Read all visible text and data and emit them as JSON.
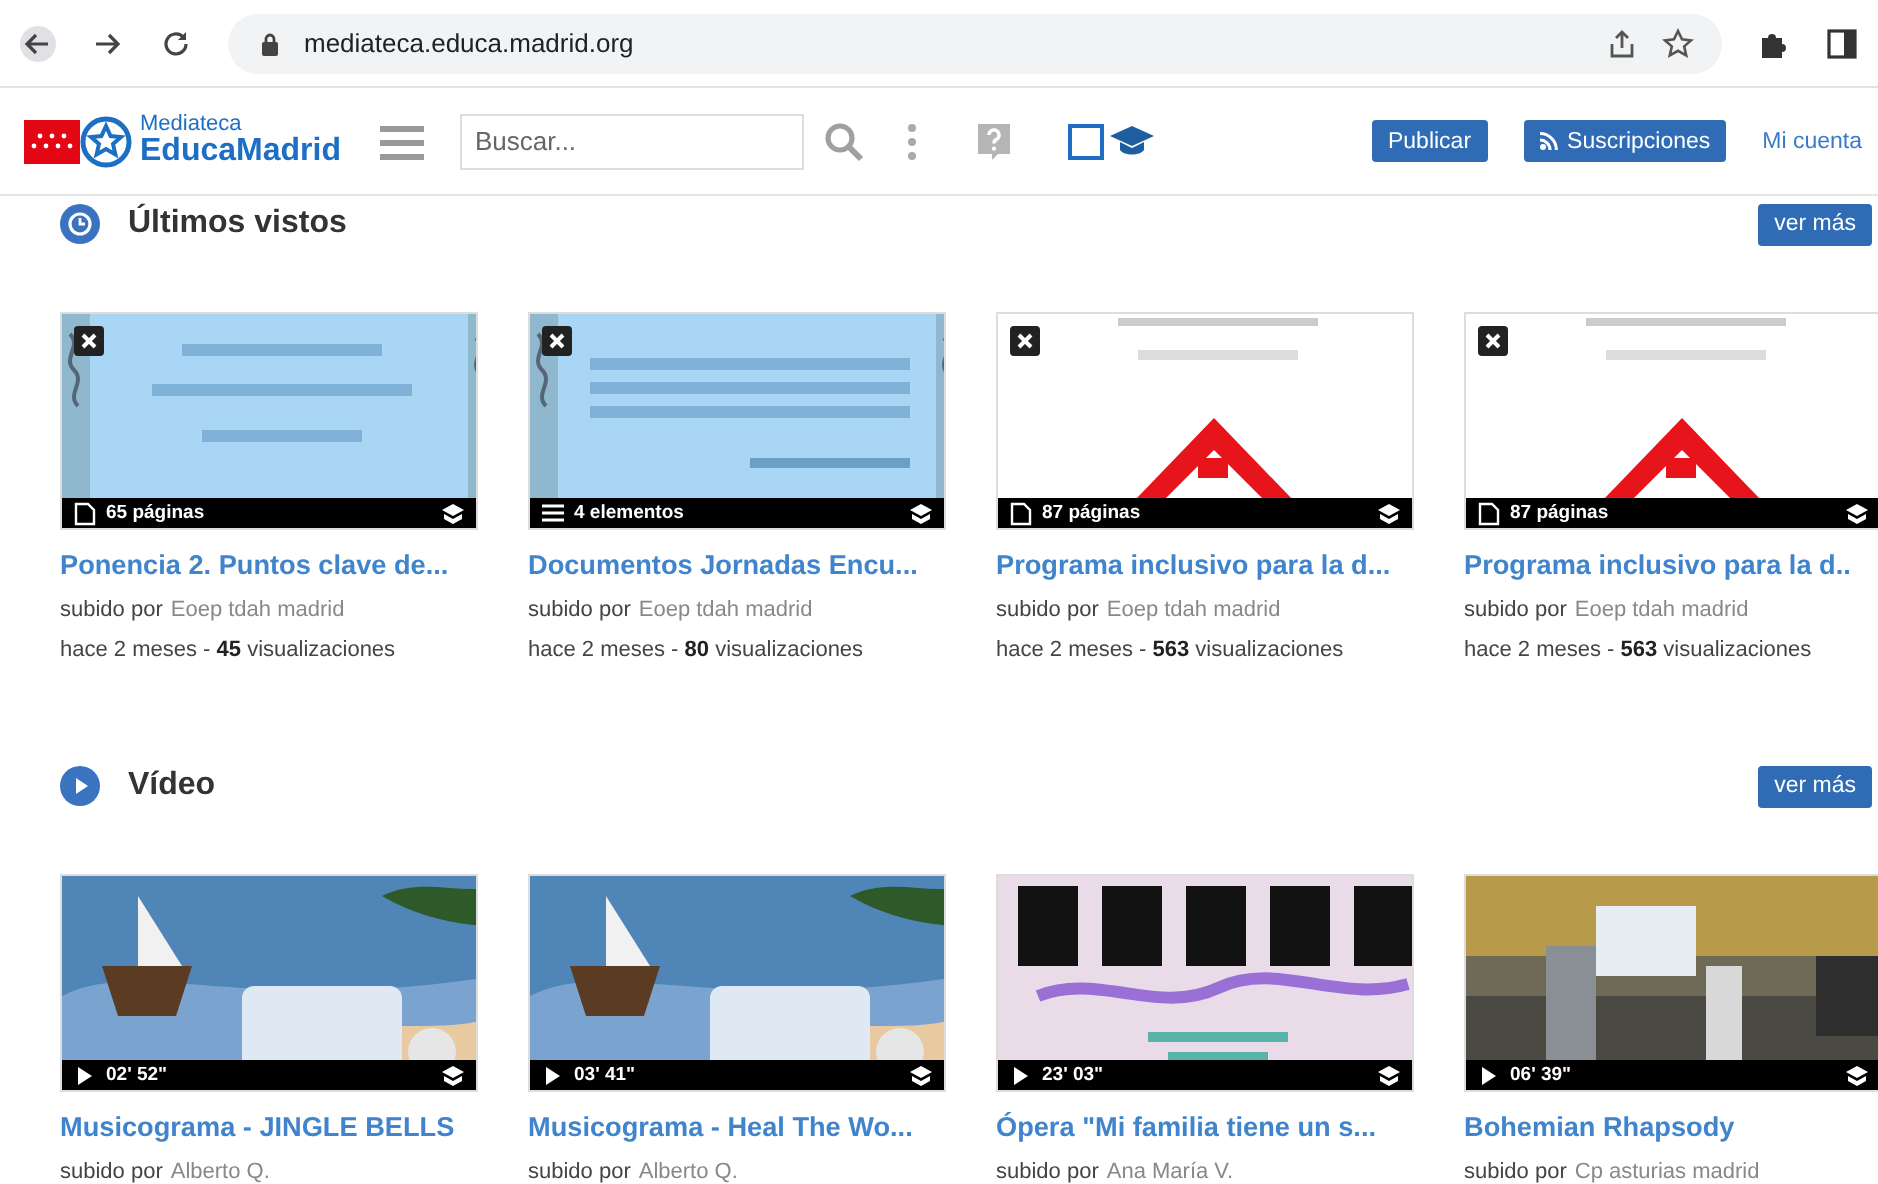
{
  "browser": {
    "url": "mediateca.educa.madrid.org"
  },
  "header": {
    "logo_top": "Mediateca",
    "logo_bottom": "EducaMadrid",
    "search": {
      "placeholder": "Buscar..."
    },
    "buttons": [
      {
        "kind": "plain",
        "label": "Publicar"
      },
      {
        "kind": "rss",
        "label": "Suscripciones"
      }
    ],
    "account_link": "Mi cuenta"
  },
  "sections": [
    {
      "kind": "clock",
      "title": "Últimos vistos",
      "more_button": "ver más",
      "cards": [
        {
          "removable": true,
          "kind": "pages",
          "badge": "65 páginas",
          "title": "Ponencia 2. Puntos clave de...",
          "uploaded_label": "subido por",
          "uploader": "Eoep tdah madrid",
          "stats": "hace 2 meses - **45** visualizaciones"
        },
        {
          "removable": true,
          "kind": "list",
          "badge": "4 elementos",
          "title": "Documentos Jornadas Encu...",
          "uploaded_label": "subido por",
          "uploader": "Eoep tdah madrid",
          "stats": "hace 2 meses - **80** visualizaciones"
        },
        {
          "removable": true,
          "kind": "pages",
          "badge": "87 páginas",
          "title": "Programa inclusivo para la d...",
          "uploaded_label": "subido por",
          "uploader": "Eoep tdah madrid",
          "stats": "hace 2 meses - **563** visualizaciones"
        },
        {
          "removable": true,
          "kind": "pages",
          "badge": "87 páginas",
          "title": "Programa inclusivo para la d..",
          "uploaded_label": "subido por",
          "uploader": "Eoep tdah madrid",
          "stats": "hace 2 meses - **563** visualizaciones"
        }
      ]
    },
    {
      "kind": "play",
      "title": "Vídeo",
      "more_button": "ver más",
      "cards": [
        {
          "removable": false,
          "kind": "video",
          "badge": "02' 52\"",
          "title": "Musicograma - JINGLE BELLS",
          "uploaded_label": "subido por",
          "uploader": "Alberto Q."
        },
        {
          "removable": false,
          "kind": "video",
          "badge": "03' 41\"",
          "title": "Musicograma - Heal The Wo...",
          "uploaded_label": "subido por",
          "uploader": "Alberto Q."
        },
        {
          "removable": false,
          "kind": "video",
          "badge": "23' 03\"",
          "title": "Ópera \"Mi familia tiene un s...",
          "uploaded_label": "subido por",
          "uploader": "Ana María V."
        },
        {
          "removable": false,
          "kind": "video",
          "badge": "06' 39\"",
          "title": "Bohemian Rhapsody",
          "uploaded_label": "subido por",
          "uploader": "Cp asturias madrid"
        }
      ]
    }
  ]
}
